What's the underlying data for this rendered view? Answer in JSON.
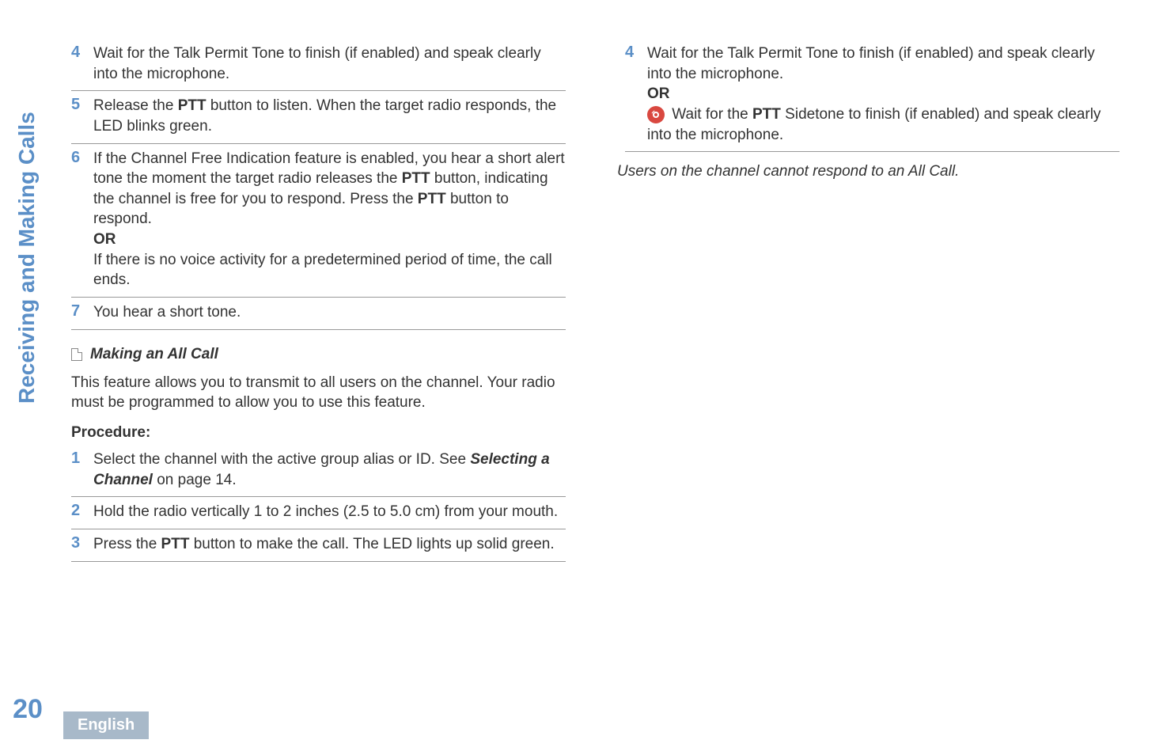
{
  "sidebar": {
    "vertical_title": "Receiving and Making Calls",
    "page_number": "20",
    "language": "English"
  },
  "left": {
    "steps_a": [
      {
        "n": "4",
        "html": "Wait for the Talk Permit Tone to finish (if enabled) and speak clearly into the microphone."
      },
      {
        "n": "5",
        "html": "Release the <b>PTT</b> button to listen. When the target radio responds, the LED blinks green."
      },
      {
        "n": "6",
        "html": "If the Channel Free Indication feature is enabled, you hear a short alert tone the moment the target radio releases the <b>PTT</b> button, indicating the channel is free for you to respond. Press the <b>PTT</b> button to respond.<br><b>OR</b><br>If there is no voice activity for a predetermined period of time, the call ends."
      },
      {
        "n": "7",
        "html": "You hear a short tone."
      }
    ],
    "section_title": "Making an All Call",
    "intro": "This feature allows you to transmit to all users on the channel. Your radio must be programmed to allow you to use this feature.",
    "procedure_label": "Procedure:",
    "steps_b": [
      {
        "n": "1",
        "html": "Select the channel with the active group alias or ID. See <b><i>Selecting a Channel</i></b> on page 14."
      },
      {
        "n": "2",
        "html": "Hold the radio vertically 1 to 2 inches (2.5 to 5.0 cm) from your mouth."
      },
      {
        "n": "3",
        "html": "Press the <b>PTT</b> button to make the call. The LED lights up solid green."
      }
    ]
  },
  "right": {
    "step4": {
      "n": "4",
      "line1": "Wait for the Talk Permit Tone to finish (if enabled) and speak clearly into the microphone.",
      "or": "OR",
      "line2_html": "Wait for the <b>PTT</b> Sidetone to finish (if enabled) and speak clearly into the microphone."
    },
    "note": "Users on the channel cannot respond to an All Call."
  }
}
